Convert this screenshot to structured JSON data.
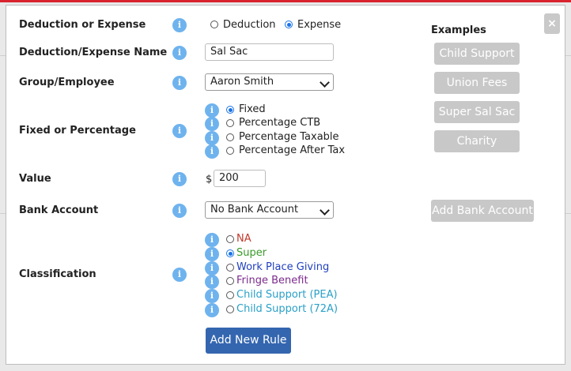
{
  "form": {
    "type_label": "Deduction or Expense",
    "type_options": [
      "Deduction",
      "Expense"
    ],
    "type_selected": "Expense",
    "name_label": "Deduction/Expense Name",
    "name_value": "Sal Sac",
    "group_label": "Group/Employee",
    "group_value": "Aaron Smith",
    "fixed_label": "Fixed or Percentage",
    "fixed_options": [
      "Fixed",
      "Percentage CTB",
      "Percentage Taxable",
      "Percentage After Tax"
    ],
    "fixed_selected": "Fixed",
    "value_label": "Value",
    "value_currency": "$",
    "value_amount": "200",
    "bank_label": "Bank Account",
    "bank_value": "No Bank Account",
    "classification_label": "Classification",
    "classification_options": [
      {
        "label": "NA",
        "color": "#c0392b"
      },
      {
        "label": "Super",
        "color": "#3a9a2a"
      },
      {
        "label": "Work Place Giving",
        "color": "#1f3fbf"
      },
      {
        "label": "Fringe Benefit",
        "color": "#7b2a8c"
      },
      {
        "label": "Child Support (PEA)",
        "color": "#2aa0c8"
      },
      {
        "label": "Child Support (72A)",
        "color": "#2aa0c8"
      }
    ],
    "classification_selected": "Super",
    "submit_label": "Add New Rule"
  },
  "examples": {
    "title": "Examples",
    "buttons": [
      "Child Support",
      "Union Fees",
      "Super Sal Sac",
      "Charity"
    ],
    "add_bank_label": "Add Bank Account"
  },
  "close_icon": "×",
  "info_icon": "i"
}
